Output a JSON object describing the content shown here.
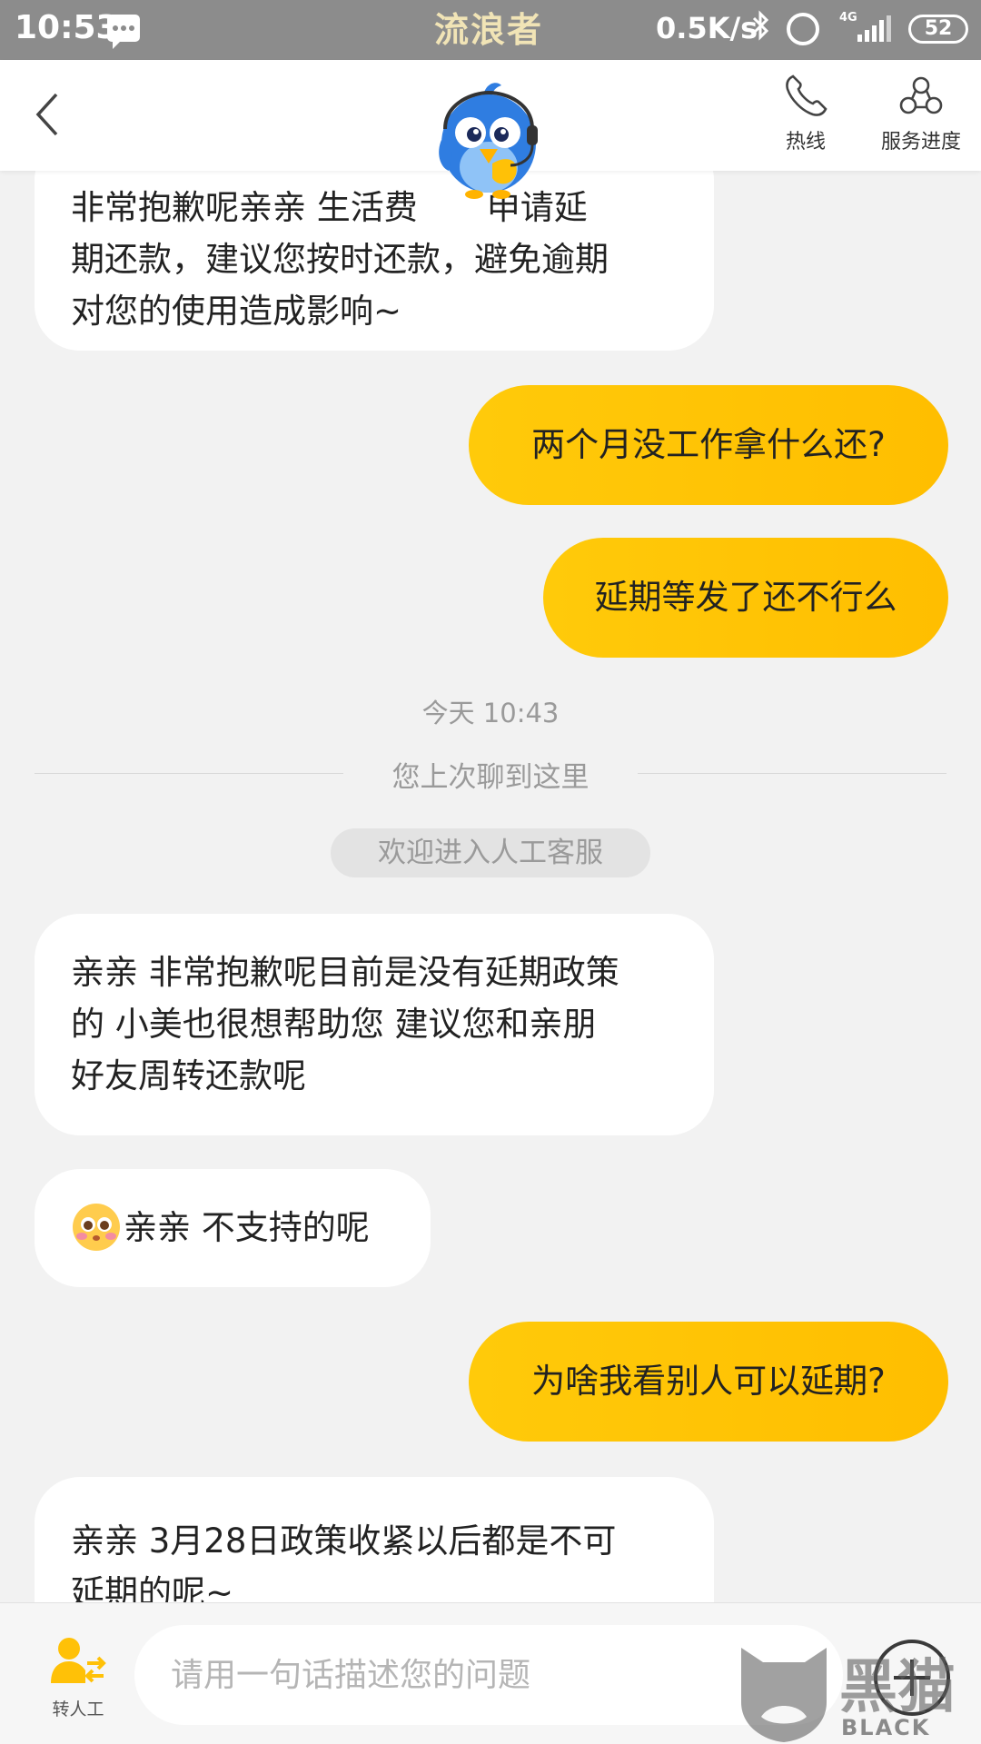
{
  "status_bar": {
    "time": "10:53",
    "watermark_text": "流浪者",
    "net_speed": "0.5K/s",
    "network_type": "4G",
    "battery": "52",
    "icons": [
      "message-icon",
      "bluetooth-icon",
      "alarm-icon",
      "signal-icon",
      "battery-icon"
    ]
  },
  "header": {
    "hotline_label": "热线",
    "progress_label": "服务进度",
    "icons": [
      "back-arrow-icon",
      "phone-icon",
      "service-progress-icon",
      "bird-mascot-icon"
    ]
  },
  "chat": {
    "messages": [
      {
        "side": "left",
        "lines": [
          "非常抱歉呢亲亲 生活费",
          "期还款，建议您按时还款，避免逾期",
          "对您的使用造成影响~"
        ],
        "line1_tail": "申请延"
      },
      {
        "side": "right",
        "text": "两个月没工作拿什么还?"
      },
      {
        "side": "right",
        "text": "延期等发了还不行么"
      },
      {
        "side": "left",
        "lines": [
          "亲亲 非常抱歉呢目前是没有延期政策",
          "的  小美也很想帮助您 建议您和亲朋",
          "好友周转还款呢"
        ]
      },
      {
        "side": "left",
        "emoji": "blushing-face-icon",
        "text": "亲亲 不支持的呢"
      },
      {
        "side": "right",
        "text": "为啥我看别人可以延期?"
      },
      {
        "side": "left",
        "lines": [
          "亲亲 3月28日政策收紧以后都是不可",
          "延期的呢~"
        ]
      }
    ],
    "timestamp": "今天 10:43",
    "divider_text": "您上次聊到这里",
    "system_notice": "欢迎进入人工客服"
  },
  "input_bar": {
    "transfer_label": "转人工",
    "placeholder": "请用一句话描述您的问题",
    "value": ""
  },
  "overlay_watermark": {
    "cn_text": "黑猫",
    "brand": "BLACK CAT"
  },
  "colors": {
    "accent_yellow": "#ffc107",
    "mascot_blue": "#2f7de1",
    "status_bar_gray": "#8c8c8c",
    "chat_background": "#f2f2f2"
  }
}
